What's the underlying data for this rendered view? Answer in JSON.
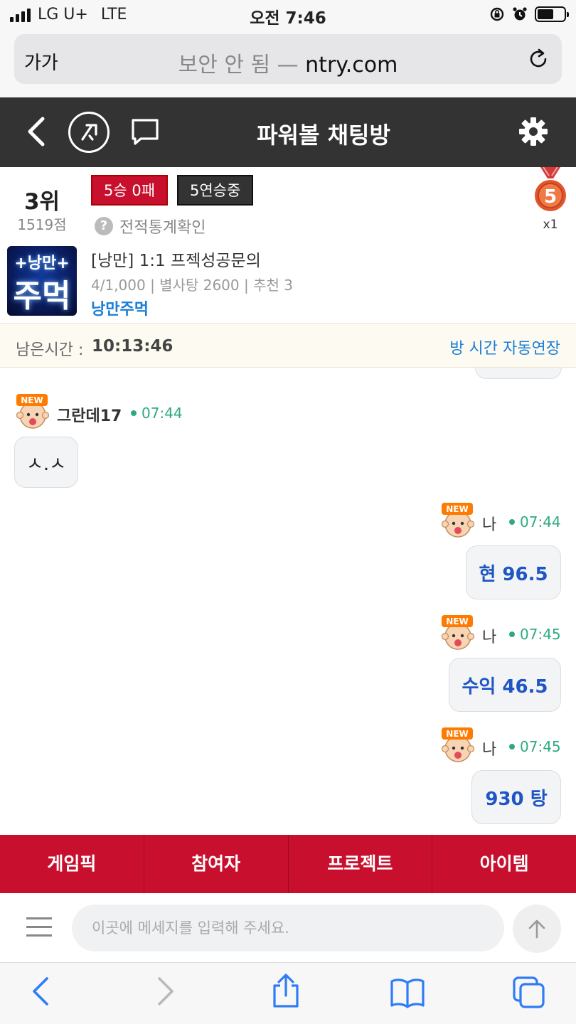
{
  "status_bar": {
    "carrier": "LG U+",
    "network": "LTE",
    "time": "오전 7:46"
  },
  "browser": {
    "text_size_label": "가가",
    "security_label": "보안 안 됨 —",
    "domain": "ntry.com"
  },
  "header": {
    "title": "파워볼 채팅방"
  },
  "profile": {
    "rank": "3위",
    "score": "1519점",
    "record_badge": "5승 0패",
    "streak_badge": "5연승중",
    "record_link": "전적통계확인",
    "medal_number": "5",
    "medal_count": "x1"
  },
  "room": {
    "thumb_line1": "+낭만+",
    "thumb_line2": "주먹",
    "title": "[낭만] 1:1 프젝성공문의",
    "meta": "4/1,000 | 별사탕 2600 | 추천 3",
    "owner": "낭만주먹"
  },
  "timer": {
    "label": "남은시간 :",
    "value": "10:13:46",
    "auto_extend_link": "방 시간 자동연장"
  },
  "messages": [
    {
      "nick": "그란데17",
      "time": "07:44",
      "text": "ㅅ.ㅅ",
      "mine": false
    },
    {
      "nick": "나",
      "time": "07:44",
      "text": "현 96.5",
      "mine": true
    },
    {
      "nick": "나",
      "time": "07:45",
      "text": "수익 46.5",
      "mine": true
    },
    {
      "nick": "나",
      "time": "07:45",
      "text": "930 탕",
      "mine": true
    }
  ],
  "avatar_badge": "NEW",
  "tabs": [
    "게임픽",
    "참여자",
    "프로젝트",
    "아이템"
  ],
  "input": {
    "placeholder": "이곳에 메세지를 입력해 주세요."
  },
  "colors": {
    "header_bg": "#333333",
    "accent_red": "#c8102e",
    "link_blue": "#1a7fd6",
    "time_green": "#2eaa7e",
    "my_message_blue": "#1f56c4"
  }
}
